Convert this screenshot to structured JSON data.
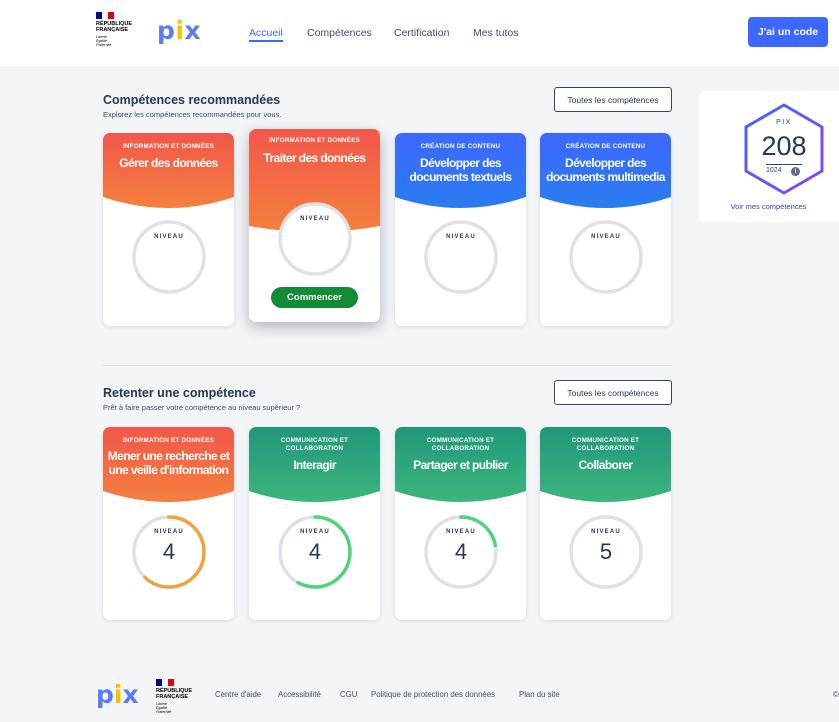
{
  "header": {
    "logo_flag_colors": [
      "#000091",
      "#ffffff",
      "#e1000f"
    ],
    "rf_line1": "RÉPUBLIQUE",
    "rf_line2": "FRANÇAISE",
    "motto": [
      "Liberté",
      "Égalité",
      "Fraternité"
    ],
    "app_logo": "pix",
    "nav": [
      {
        "label": "Accueil",
        "active": true
      },
      {
        "label": "Compétences",
        "active": false
      },
      {
        "label": "Certification",
        "active": false
      },
      {
        "label": "Mes tutos",
        "active": false
      }
    ],
    "code_button": "J'ai un code"
  },
  "recommended": {
    "title": "Compétences recommandées",
    "subtitle": "Explorez les compétences recommandées pour vous.",
    "all_button": "Toutes les compétences",
    "cards": [
      {
        "area": "INFORMATION ET DONNÉES",
        "name": "Gérer des données",
        "color": "orange",
        "level_label": "NIVEAU",
        "level": "",
        "progress": 0
      },
      {
        "area": "INFORMATION ET DONNÉES",
        "name": "Traiter des données",
        "color": "orange",
        "level_label": "NIVEAU",
        "level": "",
        "progress": 0,
        "start_button": "Commencer"
      },
      {
        "area": "CRÉATION DE CONTENU",
        "name": "Développer des documents textuels",
        "color": "blue",
        "level_label": "NIVEAU",
        "level": "",
        "progress": 0
      },
      {
        "area": "CRÉATION DE CONTENU",
        "name": "Développer des documents multimedia",
        "color": "blue",
        "level_label": "NIVEAU",
        "level": "",
        "progress": 0
      }
    ]
  },
  "retry": {
    "title": "Retenter une compétence",
    "subtitle": "Prêt à faire passer votre compétence au niveau supérieur ?",
    "all_button": "Toutes les compétences",
    "cards": [
      {
        "area": "INFORMATION ET DONNÉES",
        "name": "Mener une recherche et une veille d'information",
        "color": "orange",
        "level_label": "NIVEAU",
        "level": "4",
        "progress": 0.62
      },
      {
        "area": "COMMUNICATION ET COLLABORATION",
        "name": "Interagir",
        "color": "green",
        "level_label": "NIVEAU",
        "level": "4",
        "progress": 0.58
      },
      {
        "area": "COMMUNICATION ET COLLABORATION",
        "name": "Partager et publier",
        "color": "green",
        "level_label": "NIVEAU",
        "level": "4",
        "progress": 0.22
      },
      {
        "area": "COMMUNICATION ET COLLABORATION",
        "name": "Collaborer",
        "color": "green",
        "level_label": "NIVEAU",
        "level": "5",
        "progress": 0
      }
    ]
  },
  "score": {
    "label": "PIX",
    "value": "208",
    "max": "1024",
    "link": "Voir mes compétences"
  },
  "footer": {
    "links": [
      "Centre d'aide",
      "Accessibilité",
      "CGU",
      "Politique de protection des données",
      "Plan du site"
    ],
    "copyright": "©"
  },
  "colors": {
    "orange_top": "#f1574a",
    "orange_bottom": "#f5803e",
    "orange_gauge": "#f0a43f",
    "blue_top": "#3d68ff",
    "blue_bottom": "#2a7cf0",
    "green_top": "#20977a",
    "green_bottom": "#3cb57e",
    "green_gauge": "#52d37f",
    "primary": "#3d68ff",
    "start_button": "#128b37",
    "hex_gradient": [
      "#3d68ff",
      "#8845ff"
    ]
  }
}
